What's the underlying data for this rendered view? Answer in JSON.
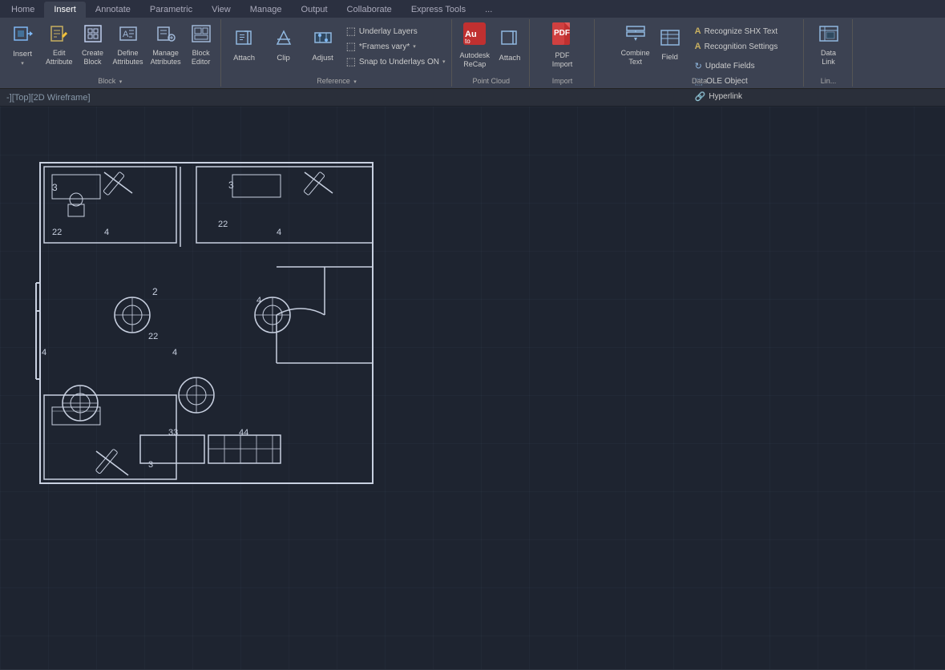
{
  "tabs": [
    {
      "label": "Home"
    },
    {
      "label": "Insert"
    },
    {
      "label": "Annotate"
    },
    {
      "label": "Parametric"
    },
    {
      "label": "View"
    },
    {
      "label": "Manage"
    },
    {
      "label": "Output"
    },
    {
      "label": "Collaborate"
    },
    {
      "label": "Express Tools"
    },
    {
      "label": "..."
    }
  ],
  "activeTab": "Insert",
  "groups": {
    "block": {
      "label": "Block",
      "buttons": [
        {
          "id": "insert",
          "icon": "⬛",
          "label": "Insert",
          "sub": "▾"
        },
        {
          "id": "edit-attribute",
          "icon": "✏",
          "label": "Edit\nAttribute"
        },
        {
          "id": "create-block",
          "icon": "⬜",
          "label": "Create\nBlock"
        },
        {
          "id": "define-attributes",
          "icon": "🔠",
          "label": "Define\nAttributes"
        },
        {
          "id": "manage-attributes",
          "icon": "🔧",
          "label": "Manage\nAttributes"
        },
        {
          "id": "block-editor",
          "icon": "📋",
          "label": "Block\nEditor"
        }
      ]
    },
    "reference": {
      "label": "Reference",
      "smallButtons": [
        {
          "id": "underlay-layers",
          "icon": "⬚",
          "label": "Underlay Layers"
        },
        {
          "id": "frames-vary",
          "icon": "⬚",
          "label": "*Frames vary*",
          "arrow": true
        },
        {
          "id": "snap-to-underlays",
          "icon": "⬚",
          "label": "Snap to Underlays ON",
          "arrow": true
        }
      ],
      "mainButtons": [
        {
          "id": "attach",
          "icon": "📎",
          "label": "Attach"
        },
        {
          "id": "clip",
          "icon": "✂",
          "label": "Clip"
        },
        {
          "id": "adjust",
          "icon": "⚙",
          "label": "Adjust"
        }
      ]
    },
    "pointCloud": {
      "label": "Point Cloud",
      "buttons": [
        {
          "id": "autocad-recap",
          "icon": "A",
          "label": "Autodesk\nReCap"
        },
        {
          "id": "attach-pc",
          "icon": "📎",
          "label": "Attach"
        }
      ]
    },
    "import": {
      "label": "Import",
      "buttons": [
        {
          "id": "pdf-import",
          "icon": "PDF",
          "label": "PDF\nImport"
        }
      ]
    },
    "data": {
      "label": "Data",
      "smallButtons": [
        {
          "id": "recognize-shx",
          "icon": "A",
          "label": "Recognize SHX Text"
        },
        {
          "id": "recognition-settings",
          "icon": "A",
          "label": "Recognition Settings"
        },
        {
          "id": "update-fields",
          "icon": "↻",
          "label": "Update Fields"
        },
        {
          "id": "ole-object",
          "icon": "⬚",
          "label": "OLE Object"
        },
        {
          "id": "hyperlink",
          "icon": "🔗",
          "label": "Hyperlink"
        }
      ],
      "mainButtons": [
        {
          "id": "combine-text",
          "icon": "≡",
          "label": "Combine\nText"
        },
        {
          "id": "field",
          "icon": "▦",
          "label": "Field"
        }
      ]
    },
    "link": {
      "label": "Lin...",
      "buttons": [
        {
          "id": "data-link",
          "icon": "⬚",
          "label": "Data\nLink"
        }
      ]
    }
  },
  "viewBar": {
    "text": "-][Top][2D Wireframe]"
  },
  "floorplan": {
    "numbers": [
      "3",
      "22",
      "4",
      "3",
      "22",
      "4",
      "4",
      "33",
      "22",
      "44",
      "4",
      "3"
    ],
    "description": "Office floor plan with chairs, desks, and workstations"
  }
}
